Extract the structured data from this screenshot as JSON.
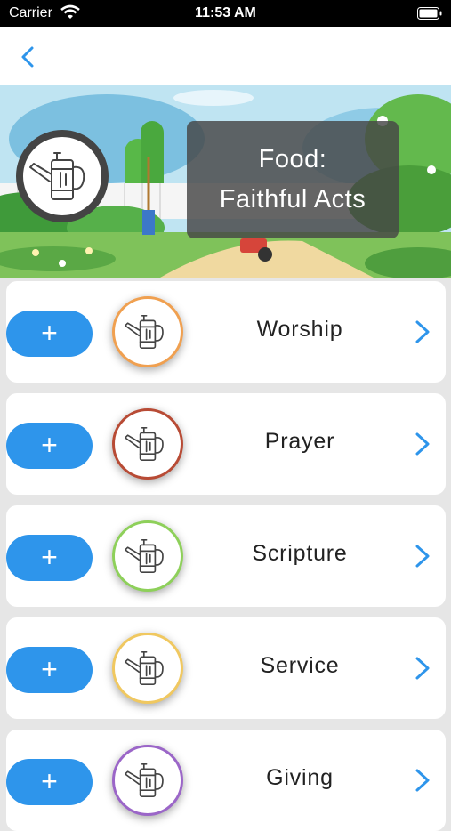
{
  "status_bar": {
    "carrier": "Carrier",
    "time": "11:53 AM"
  },
  "header": {
    "title_line1": "Food:",
    "title_line2": "Faithful Acts",
    "icon": "watering-can-icon"
  },
  "add_label": "+",
  "items": [
    {
      "label": "Worship",
      "ring_color": "#f0a050"
    },
    {
      "label": "Prayer",
      "ring_color": "#b84b35"
    },
    {
      "label": "Scripture",
      "ring_color": "#8ed05a"
    },
    {
      "label": "Service",
      "ring_color": "#f0c860"
    },
    {
      "label": "Giving",
      "ring_color": "#9b66c8"
    }
  ],
  "colors": {
    "accent": "#2e95eb"
  }
}
